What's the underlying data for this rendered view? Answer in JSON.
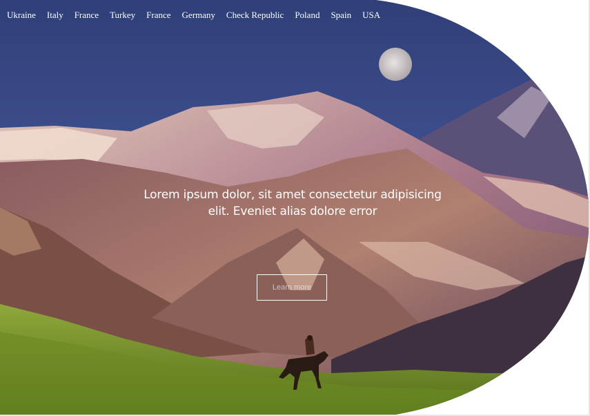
{
  "nav": {
    "items": [
      "Ukraine",
      "Italy",
      "France",
      "Turkey",
      "France",
      "Germany",
      "Check Republic",
      "Poland",
      "Spain",
      "USA"
    ]
  },
  "hero": {
    "headline": "Lorem ipsum dolor, sit amet consectetur adipisicing elit. Eveniet alias dolore error",
    "button_label": "Learn more",
    "image_alt": "Mountain valley at dusk with a horse rider and full moon"
  },
  "colors": {
    "sky": "#3c4c84",
    "mountain_light": "#d9b7a6",
    "mountain_dark": "#3e2f4a",
    "meadow": "#7c9a2a"
  }
}
